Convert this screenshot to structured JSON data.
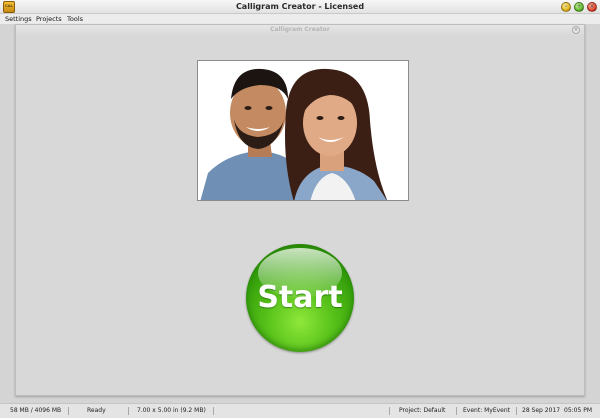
{
  "window": {
    "title": "Calligram Creator - Licensed",
    "app_icon_text": "CAL"
  },
  "menu": {
    "items": [
      "Settings",
      "Projects",
      "Tools"
    ]
  },
  "panel": {
    "title": "Calligram Creator",
    "close_symbol": "×"
  },
  "start_button": {
    "label": "Start",
    "color": "#3fa80c"
  },
  "status": {
    "memory": "58 MB / 4096 MB",
    "state": "Ready",
    "size": "7.00 x 5.00 in  (9.2 MB)",
    "project": "Project: Default",
    "event": "Event: MyEvent",
    "date": "28 Sep 2017",
    "time": "05:05 PM"
  },
  "icons": {
    "minimize": "minimize-icon",
    "maximize": "maximize-icon",
    "close": "close-icon"
  }
}
